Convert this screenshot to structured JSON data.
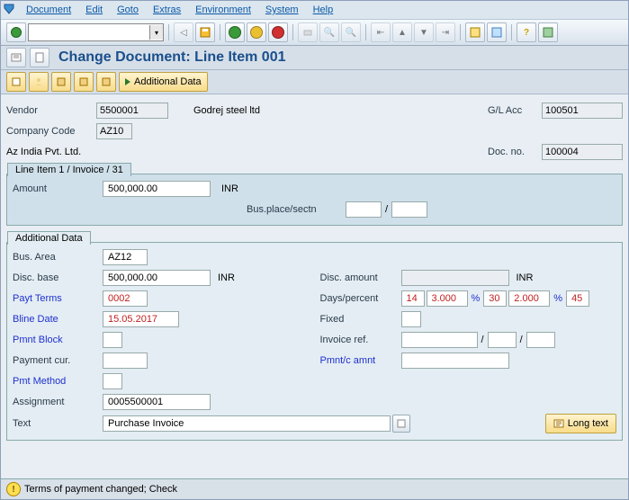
{
  "menu": {
    "document": "Document",
    "edit": "Edit",
    "goto": "Goto",
    "extras": "Extras",
    "environment": "Environment",
    "system": "System",
    "help": "Help"
  },
  "title": "Change Document: Line Item 001",
  "apptool": {
    "additional_data": "Additional Data"
  },
  "header": {
    "vendor_lbl": "Vendor",
    "vendor": "5500001",
    "vendor_name": "Godrej steel ltd",
    "glacc_lbl": "G/L Acc",
    "glacc": "100501",
    "company_lbl": "Company Code",
    "company": "AZ10",
    "company_name": "Az India Pvt. Ltd.",
    "docno_lbl": "Doc. no.",
    "docno": "100004"
  },
  "lineitem": {
    "tab": "Line Item 1 / Invoice / 31",
    "amount_lbl": "Amount",
    "amount": "500,000.00",
    "curr": "INR",
    "busplace_lbl": "Bus.place/sectn",
    "busplace": ""
  },
  "additional": {
    "tab": "Additional Data",
    "busarea_lbl": "Bus. Area",
    "busarea": "AZ12",
    "discbase_lbl": "Disc. base",
    "discbase": "500,000.00",
    "curr": "INR",
    "discamount_lbl": "Disc. amount",
    "discamount": "",
    "curr2": "INR",
    "payt_lbl": "Payt Terms",
    "payt": "0002",
    "dayspct_lbl": "Days/percent",
    "d1": "14",
    "p1": "3.000",
    "d2": "30",
    "p2": "2.000",
    "d3": "45",
    "pct": "%",
    "bline_lbl": "Bline Date",
    "bline": "15.05.2017",
    "fixed_lbl": "Fixed",
    "fixed": "",
    "pmntblock_lbl": "Pmnt Block",
    "pmntblock": "",
    "invref_lbl": "Invoice ref.",
    "invref1": "",
    "invref2": "",
    "invref3": "",
    "paymentcur_lbl": "Payment cur.",
    "paymentcur": "",
    "pmntcamnt_lbl": "Pmnt/c amnt",
    "pmntcamnt": "",
    "pmtmethod_lbl": "Pmt Method",
    "pmtmethod": "",
    "assignment_lbl": "Assignment",
    "assignment": "0005500001",
    "text_lbl": "Text",
    "text": "Purchase Invoice",
    "longtext_btn": "Long text"
  },
  "status": {
    "message": "Terms of payment changed; Check"
  }
}
